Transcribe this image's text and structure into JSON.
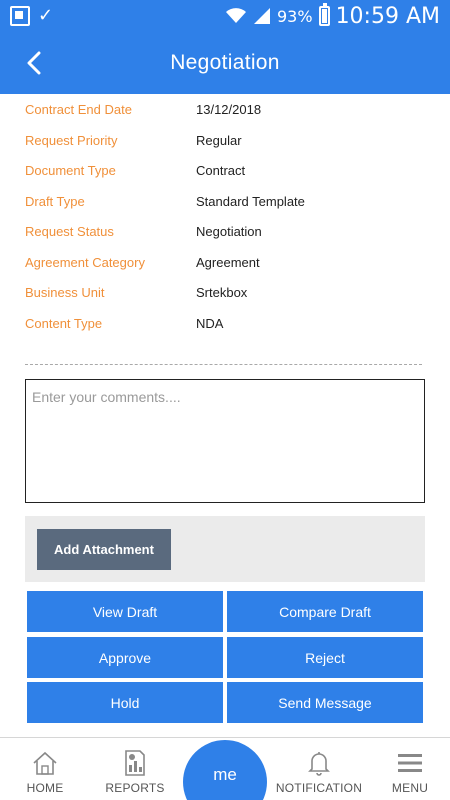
{
  "status_bar": {
    "battery_percent": "93%",
    "time": "10:59 AM"
  },
  "header": {
    "title": "Negotiation"
  },
  "details": [
    {
      "label": "Contract End Date",
      "value": "13/12/2018"
    },
    {
      "label": "Request Priority",
      "value": "Regular"
    },
    {
      "label": "Document Type",
      "value": "Contract"
    },
    {
      "label": "Draft Type",
      "value": "Standard Template"
    },
    {
      "label": "Request Status",
      "value": "Negotiation"
    },
    {
      "label": "Agreement Category",
      "value": "Agreement"
    },
    {
      "label": "Business Unit",
      "value": "Srtekbox"
    },
    {
      "label": "Content Type",
      "value": "NDA"
    }
  ],
  "comments": {
    "placeholder": "Enter your comments....",
    "value": ""
  },
  "attachment": {
    "button_label": "Add Attachment"
  },
  "actions": {
    "view_draft": "View Draft",
    "compare_draft": "Compare Draft",
    "approve": "Approve",
    "reject": "Reject",
    "hold": "Hold",
    "send_message": "Send Message"
  },
  "nav": {
    "home": "HOME",
    "reports": "REPORTS",
    "me": "me",
    "notification": "NOTIFICATION",
    "menu": "MENU"
  },
  "colors": {
    "primary": "#2f80e8",
    "label_orange": "#f0903a",
    "attach_button": "#5a6a7e"
  },
  "icons": {
    "status_left": [
      "app-icon",
      "check-icon"
    ],
    "status_right": [
      "wifi-icon",
      "signal-icon",
      "battery-icon"
    ],
    "header": "back-arrow-icon",
    "nav": [
      "home-icon",
      "reports-icon",
      "bell-icon",
      "hamburger-icon"
    ]
  }
}
